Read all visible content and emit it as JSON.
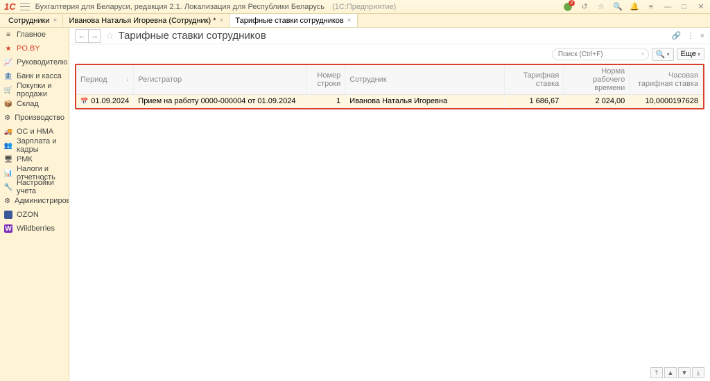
{
  "titlebar": {
    "app_title": "Бухгалтерия для Беларуси, редакция 2.1. Локализация для Республики Беларусь",
    "platform": "(1С:Предприятие)",
    "notification_count": "2"
  },
  "tabs": [
    {
      "label": "Сотрудники"
    },
    {
      "label": "Иванова Наталья Игоревна (Сотрудник) *"
    },
    {
      "label": "Тарифные ставки сотрудников"
    }
  ],
  "sidebar": {
    "items": [
      {
        "label": "Главное"
      },
      {
        "label": "PO.BY"
      },
      {
        "label": "Руководителю"
      },
      {
        "label": "Банк и касса"
      },
      {
        "label": "Покупки и продажи"
      },
      {
        "label": "Склад"
      },
      {
        "label": "Производство"
      },
      {
        "label": "ОС и НМА"
      },
      {
        "label": "Зарплата и кадры"
      },
      {
        "label": "РМК"
      },
      {
        "label": "Налоги и отчетность"
      },
      {
        "label": "Настройки учета"
      },
      {
        "label": "Администрирование"
      },
      {
        "label": "OZON"
      },
      {
        "label": "Wildberries"
      }
    ]
  },
  "page": {
    "title": "Тарифные ставки сотрудников"
  },
  "toolbar": {
    "search_placeholder": "Поиск (Ctrl+F)",
    "more_label": "Еще"
  },
  "table": {
    "headers": {
      "period": "Период",
      "registrar": "Регистратор",
      "line_number": "Номер строки",
      "employee": "Сотрудник",
      "tariff_rate": "Тарифная ставка",
      "work_time_norm": "Норма рабочего времени",
      "hourly_rate": "Часовая тарифная ставка"
    },
    "rows": [
      {
        "period": "01.09.2024",
        "registrar": "Прием на работу 0000-000004 от 01.09.2024",
        "line_number": "1",
        "employee": "Иванова Наталья Игоревна",
        "tariff_rate": "1 686,67",
        "work_time_norm": "2 024,00",
        "hourly_rate": "10,0000197628"
      }
    ]
  }
}
